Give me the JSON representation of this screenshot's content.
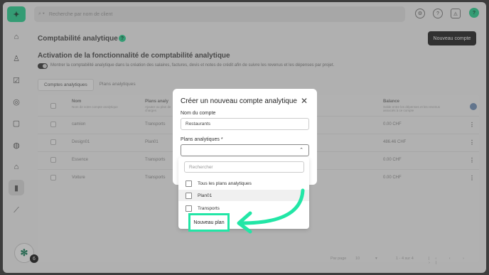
{
  "app": {
    "logo_text": "✦"
  },
  "topbar": {
    "search_placeholder": "Recherche par nom de client",
    "icons": [
      "settings-icon",
      "help-icon",
      "bell-icon",
      "user-icon"
    ],
    "user_badge": "?"
  },
  "sidebar": {
    "icons": [
      "home-icon",
      "users-icon",
      "check-icon",
      "money-icon",
      "bag-icon",
      "globe-icon",
      "bank-icon",
      "ledger-icon",
      "chart-icon"
    ],
    "help_badge": "6"
  },
  "page": {
    "title": "Comptabilité analytique",
    "help_marker": "?",
    "new_account_button": "Nouveau compte",
    "section_title": "Activation de la fonctionnalité de comptabilité analytique",
    "toggle_description": "Montrer la comptabilité analytique dans la création des salaires, factures, devis et notes de crédit afin de suivre les revenus et les dépenses par projet.",
    "tabs": [
      "Comptes analytiques",
      "Plans analytiques"
    ]
  },
  "table": {
    "columns": [
      {
        "title": "Nom",
        "subtitle": "Nom de votre compte analytique"
      },
      {
        "title": "Plans analy",
        "subtitle": "Ajouter ou plan de charges"
      },
      {
        "title": "Balance",
        "subtitle": "Solde entre les dépenses et les revenus associés à ce compte"
      }
    ],
    "rows": [
      {
        "name": "camion",
        "plan": "Transports",
        "balance": "0.00 CHF"
      },
      {
        "name": "Design01",
        "plan": "Plan01",
        "balance": "486.46 CHF"
      },
      {
        "name": "Essence",
        "plan": "Transports",
        "balance": "0.00 CHF"
      },
      {
        "name": "Voiture",
        "plan": "Transports",
        "balance": "0.00 CHF"
      }
    ],
    "per_page_label": "Par page",
    "per_page_value": "10",
    "range": "1 - 4 sur 4"
  },
  "modal": {
    "title": "Créer un nouveau compte analytique",
    "account_name_label": "Nom du compte",
    "account_name_value": "Restaurants",
    "plans_label": "Plans analytiques *",
    "dropdown": {
      "search_placeholder": "Rechercher",
      "all_plans": "Tous les plans analytiques",
      "options": [
        "Plan01",
        "Transports"
      ],
      "new_plan": "Nouveau plan"
    }
  },
  "accent_color": "#22e6a6"
}
